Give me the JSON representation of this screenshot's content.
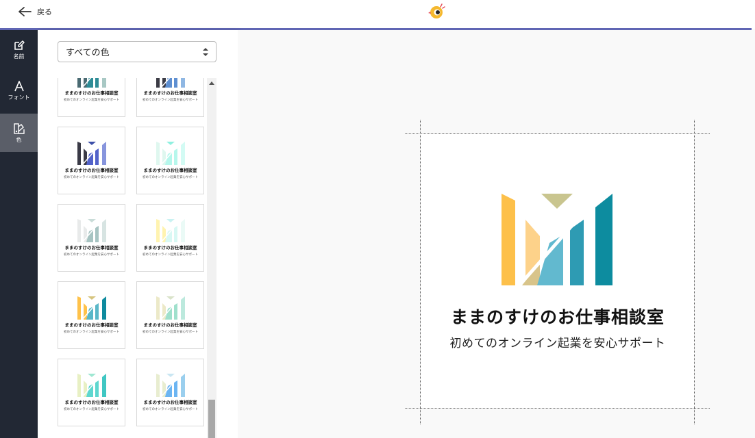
{
  "header": {
    "back_label": "戻る",
    "back_icon": "arrow-left-icon",
    "app_logo_icon": "bird-logo-icon",
    "accent_color": "#6066b4"
  },
  "sidebar": {
    "items": [
      {
        "label": "名前",
        "icon": "edit-icon"
      },
      {
        "label": "フォント",
        "icon": "font-icon"
      },
      {
        "label": "色",
        "icon": "color-palette-icon",
        "active": true
      }
    ]
  },
  "color_panel": {
    "filter_selected": "すべての色",
    "card_title": "ままのすけのお仕事相談室",
    "card_subtitle": "初めてのオンライン起業を安心サポート",
    "palettes": [
      {
        "colors": [
          "#4a6a72",
          "#6fa9a6",
          "#2e8c96",
          "#a8c8c4"
        ]
      },
      {
        "colors": [
          "#3b3b45",
          "#4e6fb4",
          "#5e8fd1",
          "#8fb7e3"
        ]
      },
      {
        "colors": [
          "#3a3a46",
          "#3d4fa8",
          "#5262c9",
          "#8795dd"
        ]
      },
      {
        "colors": [
          "#dff7ef",
          "#8ff0e0",
          "#b6f7ec",
          "#d3fbf4"
        ]
      },
      {
        "colors": [
          "#e8eaea",
          "#c9dcd8",
          "#a7c4c2",
          "#d7e4e2"
        ]
      },
      {
        "colors": [
          "#fff3b0",
          "#c9f2f2",
          "#d8f8f4",
          "#eafaf6"
        ]
      },
      {
        "colors": [
          "#ffc24a",
          "#d6c47e",
          "#5ab7c8",
          "#0e8a9e"
        ]
      },
      {
        "colors": [
          "#ece9c8",
          "#d9e3c9",
          "#9fe0cc",
          "#bce9dd"
        ]
      },
      {
        "colors": [
          "#e8f0c4",
          "#9fe7d2",
          "#5ed7cf",
          "#40c7c3"
        ]
      },
      {
        "colors": [
          "#e8edd0",
          "#c9e6f2",
          "#6cb5f2",
          "#9acfee"
        ]
      }
    ]
  },
  "preview": {
    "title": "ままのすけのお仕事相談室",
    "subtitle": "初めてのオンライン起業を安心サポート",
    "logo_colors": {
      "left": "#fdc04a",
      "left_light": "#fdd28a",
      "khaki": "#c9c58f",
      "tan": "#d8c48a",
      "teal_light": "#62b9cf",
      "teal": "#2e9bb3",
      "teal_dark": "#0d8c9f"
    }
  }
}
